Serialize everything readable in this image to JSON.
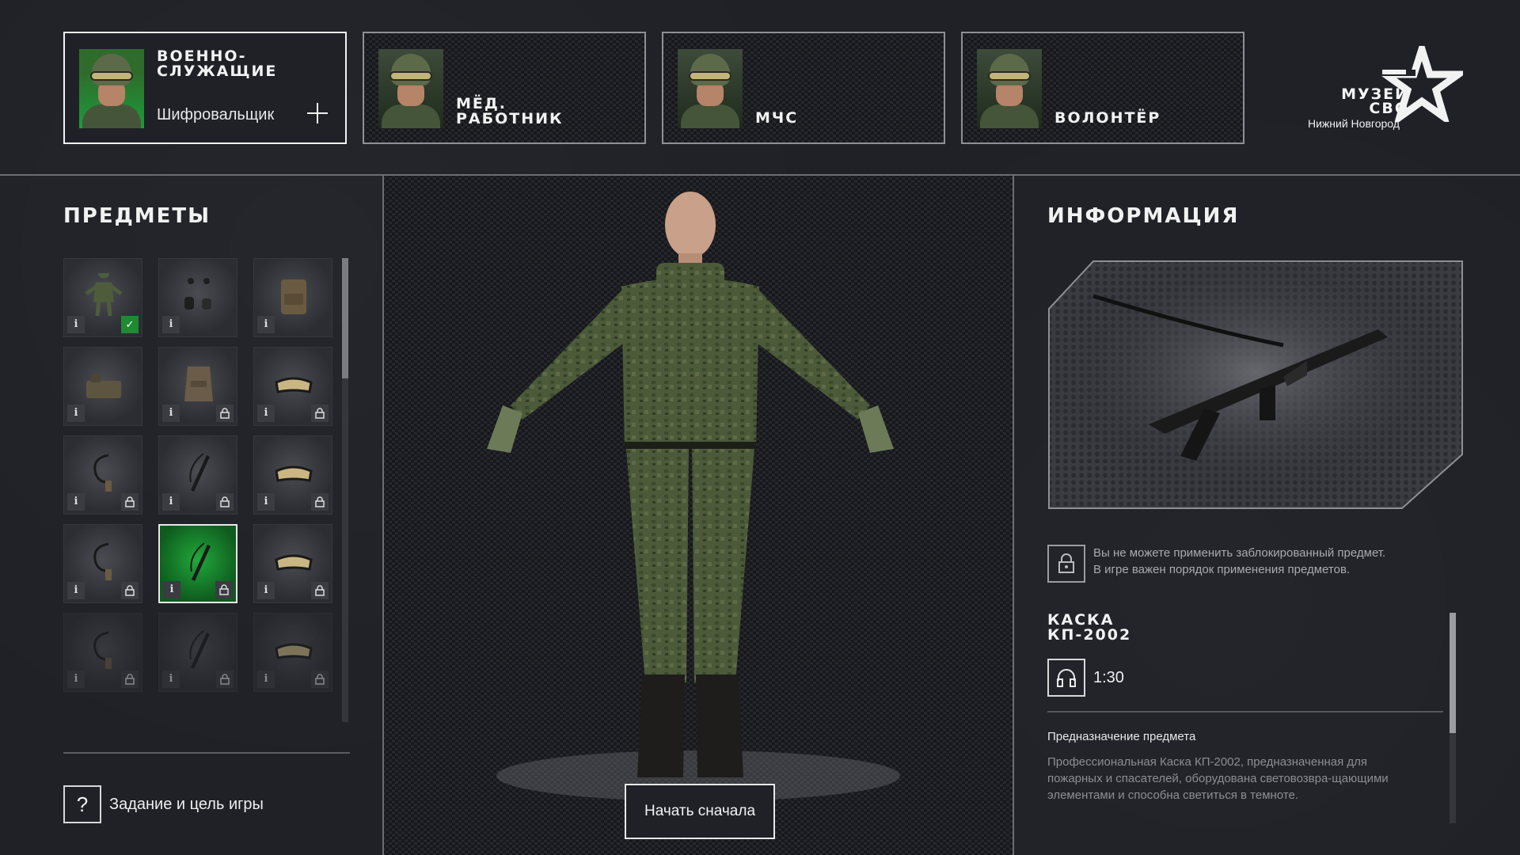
{
  "roles": [
    {
      "title_line1": "Военно-",
      "title_line2": "служащие",
      "subtitle": "Шифровальщик",
      "active": true
    },
    {
      "title_line1": "Мёд.",
      "title_line2": "работник",
      "active": false
    },
    {
      "title_line1": "МЧС",
      "title_line2": "",
      "active": false
    },
    {
      "title_line1": "Волонтёр",
      "title_line2": "",
      "active": false
    }
  ],
  "logo": {
    "line1": "Музей",
    "line2": "СВО",
    "city": "Нижний Новгород"
  },
  "items_panel": {
    "title": "Предметы",
    "info_glyph": "i",
    "items": [
      {
        "icon": "uniform-icon",
        "state": "equipped"
      },
      {
        "icon": "gloves-icon",
        "state": "available"
      },
      {
        "icon": "backpack-icon",
        "state": "available"
      },
      {
        "icon": "vest-bags-icon",
        "state": "available"
      },
      {
        "icon": "body-armor-icon",
        "state": "locked"
      },
      {
        "icon": "goggles-icon",
        "state": "locked"
      },
      {
        "icon": "radio-icon",
        "state": "locked"
      },
      {
        "icon": "rifle-icon",
        "state": "locked"
      },
      {
        "icon": "goggles-icon",
        "state": "locked"
      },
      {
        "icon": "radio-icon",
        "state": "locked"
      },
      {
        "icon": "rifle-icon",
        "state": "selected-locked"
      },
      {
        "icon": "goggles-icon",
        "state": "locked"
      },
      {
        "icon": "radio-icon",
        "state": "locked-faded"
      },
      {
        "icon": "rifle-icon",
        "state": "locked-faded"
      },
      {
        "icon": "goggles-icon",
        "state": "locked-faded"
      }
    ],
    "task_button": "Задание и цель игры"
  },
  "center": {
    "restart_button": "Начать сначала"
  },
  "info_panel": {
    "title": "Информация",
    "lock_notice_line1": "Вы не можете применить заблокированный предмет.",
    "lock_notice_line2": "В игре важен порядок применения предметов.",
    "item_title_line1": "Каска",
    "item_title_line2": "КП-2002",
    "audio_duration": "1:30",
    "purpose_label": "Предназначение предмета",
    "purpose_text": "Профессиональная Каска КП-2002, предназначенная для пожарных и спасателей, оборудована световозвра-щающими элементами и способна светиться в темноте."
  },
  "colors": {
    "accent_green": "#1f8a33",
    "background": "#1f2127",
    "border": "#8e9096"
  }
}
